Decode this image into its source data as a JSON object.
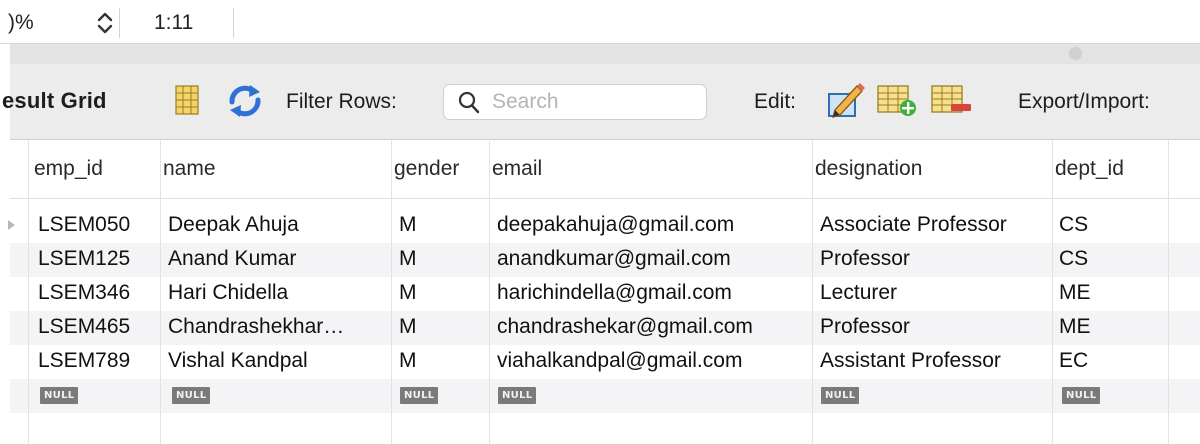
{
  "statusbar": {
    "zoom_value": ")%",
    "cursor_position": "1:11"
  },
  "toolbar": {
    "title": "esult Grid",
    "filter_label": "Filter Rows:",
    "search_placeholder": "Search",
    "edit_label": "Edit:",
    "export_label": "Export/Import:"
  },
  "grid": {
    "columns": [
      "emp_id",
      "name",
      "gender",
      "email",
      "designation",
      "dept_id"
    ],
    "rows": [
      [
        "LSEM050",
        "Deepak Ahuja",
        "M",
        "deepakahuja@gmail.com",
        "Associate Professor",
        "CS"
      ],
      [
        "LSEM125",
        "Anand Kumar",
        "M",
        "anandkumar@gmail.com",
        "Professor",
        "CS"
      ],
      [
        "LSEM346",
        "Hari Chidella",
        "M",
        "harichindella@gmail.com",
        "Lecturer",
        "ME"
      ],
      [
        "LSEM465",
        "Chandrashekhar…",
        "M",
        "chandrashekar@gmail.com",
        "Professor",
        "ME"
      ],
      [
        "LSEM789",
        "Vishal Kandpal",
        "M",
        "viahalkandpal@gmail.com",
        "Assistant Professor",
        "EC"
      ]
    ],
    "null_label": "NULL"
  },
  "icons": {
    "zoom_stepper": "up-down-chevron-icon",
    "toggle_panel": "column-panel-icon",
    "refresh": "refresh-arrows-icon",
    "search": "magnifier-icon",
    "edit_cell": "pencil-edit-icon",
    "add_row": "table-add-row-icon",
    "delete_row": "table-delete-row-icon"
  },
  "colors": {
    "toolbar_bg": "#ececec",
    "alt_row_bg": "#f4f4f6",
    "null_badge_bg": "#7a7a7a",
    "refresh_blue": "#2f6fd6"
  }
}
